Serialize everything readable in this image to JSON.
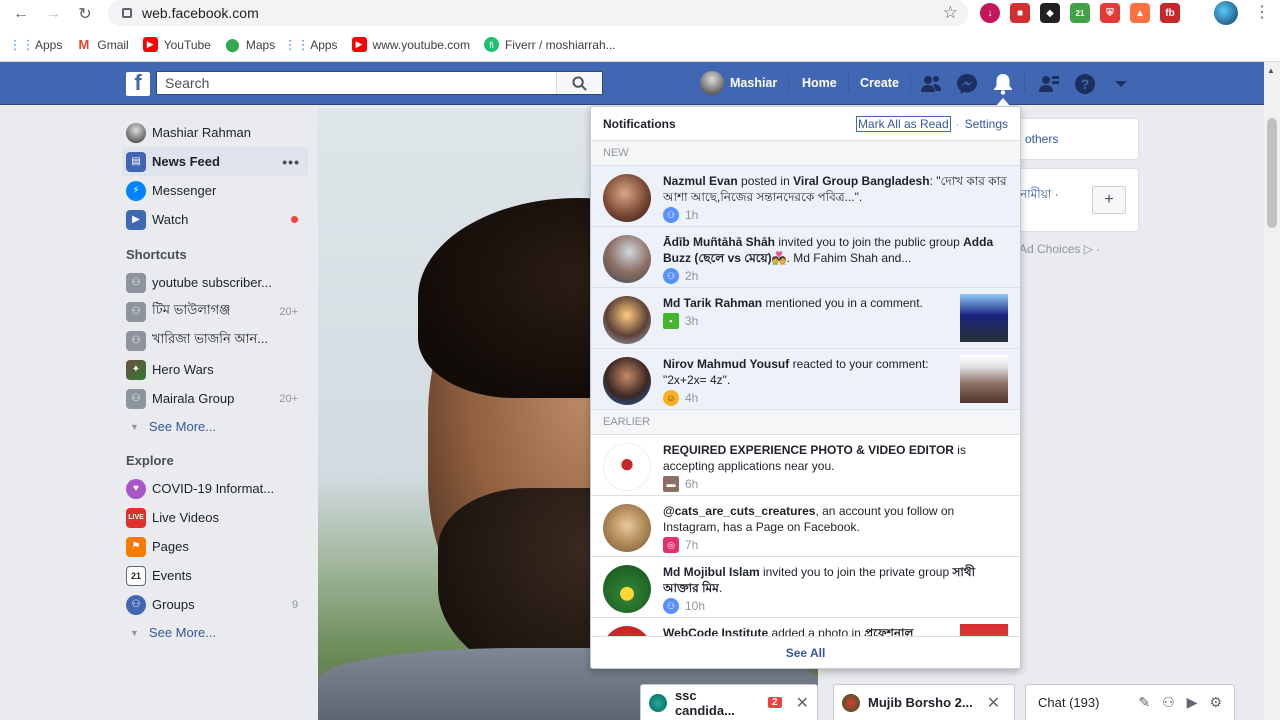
{
  "browser": {
    "url": "web.facebook.com",
    "bookmarks": [
      {
        "label": "Apps",
        "icon": "apps-grid-icon",
        "color": "#ea4335"
      },
      {
        "label": "Gmail",
        "icon": "gmail-icon",
        "color": "#ea4335"
      },
      {
        "label": "YouTube",
        "icon": "youtube-icon",
        "color": "#ff0000"
      },
      {
        "label": "Maps",
        "icon": "maps-pin-icon",
        "color": "#34a853"
      },
      {
        "label": "Apps",
        "icon": "apps-grid-icon",
        "color": "#4285f4"
      },
      {
        "label": "www.youtube.com",
        "icon": "youtube-icon",
        "color": "#ff0000"
      },
      {
        "label": "Fiverr / moshiarrah...",
        "icon": "fiverr-icon",
        "color": "#1dbf73"
      }
    ],
    "ext_badge": "21"
  },
  "fb_bar": {
    "logo": "f",
    "search_placeholder": "Search",
    "user_name": "Mashiar",
    "home": "Home",
    "create": "Create",
    "brand_color": "#4267b2"
  },
  "leftnav": {
    "profile": "Mashiar Rahman",
    "main": [
      {
        "label": "News Feed",
        "more": "•••"
      },
      {
        "label": "Messenger"
      },
      {
        "label": "Watch"
      }
    ],
    "shortcuts_heading": "Shortcuts",
    "shortcuts": [
      {
        "label": "youtube subscriber...",
        "count": ""
      },
      {
        "label": "টিম ভাউলাগঞ্জ",
        "count": "20+"
      },
      {
        "label": "খারিজা ভাজনি আন...",
        "count": ""
      },
      {
        "label": "Hero Wars",
        "count": ""
      },
      {
        "label": "Mairala Group",
        "count": "20+"
      }
    ],
    "see_more": "See More...",
    "explore_heading": "Explore",
    "explore": [
      {
        "label": "COVID-19 Informat...",
        "count": ""
      },
      {
        "label": "Live Videos",
        "count": "",
        "icon_text": "LIVE"
      },
      {
        "label": "Pages",
        "count": ""
      },
      {
        "label": "Events",
        "count": "",
        "icon_text": "21"
      },
      {
        "label": "Groups",
        "count": "9"
      }
    ],
    "see_more_2": "See More..."
  },
  "right": {
    "others": "others",
    "bn_text": "নামীয়া ·",
    "plus": "+",
    "ad_choices": "Ad Choices ▷ ·"
  },
  "notifications": {
    "title": "Notifications",
    "mark_all": "Mark All as Read",
    "settings": "Settings",
    "new_label": "NEW",
    "earlier_label": "EARLIER",
    "see_all": "See All",
    "items": [
      {
        "actor": "Nazmul Evan",
        "text": " posted in ",
        "target": "Viral Group Bangladesh",
        "rest": ": \"দোখ কার কার আশা আছে,নিজের সন্তানদেরকে পবিত্র...\".",
        "time": "1h"
      },
      {
        "actor": "Ādīb Muñtāhā Shāh",
        "text": " invited you to join the public group ",
        "target": "Adda Buzz (ছেলে vs মেয়ে)💑",
        "rest": ". Md Fahim Shah and...",
        "time": "2h"
      },
      {
        "actor": "Md Tarik Rahman",
        "text": " mentioned you in a comment.",
        "target": "",
        "rest": "",
        "time": "3h"
      },
      {
        "actor": "Nirov Mahmud Yousuf",
        "text": " reacted to your comment: \"2x+2x= 4z\".",
        "target": "",
        "rest": "",
        "time": "4h"
      },
      {
        "actor": "REQUIRED EXPERIENCE PHOTO & VIDEO EDITOR",
        "text": " is accepting applications near you.",
        "target": "",
        "rest": "",
        "time": "6h"
      },
      {
        "actor": "@cats_are_cuts_creatures",
        "text": ", an account you follow on Instagram, has a Page on Facebook.",
        "target": "",
        "rest": "",
        "time": "7h"
      },
      {
        "actor": "Md Mojibul Islam",
        "text": " invited you to join the private group ",
        "target": "সাথী আক্তার মিম",
        "rest": ".",
        "time": "10h"
      },
      {
        "actor": "WebCode Institute",
        "text": " added a photo in ",
        "target": "প্রফেশনাল",
        "rest": "",
        "time": ""
      }
    ]
  },
  "chat": {
    "tab1": {
      "label": "ssc candida...",
      "count": "2"
    },
    "tab2": {
      "label": "Mujib Borsho 2..."
    },
    "bar_label": "Chat (193)"
  }
}
